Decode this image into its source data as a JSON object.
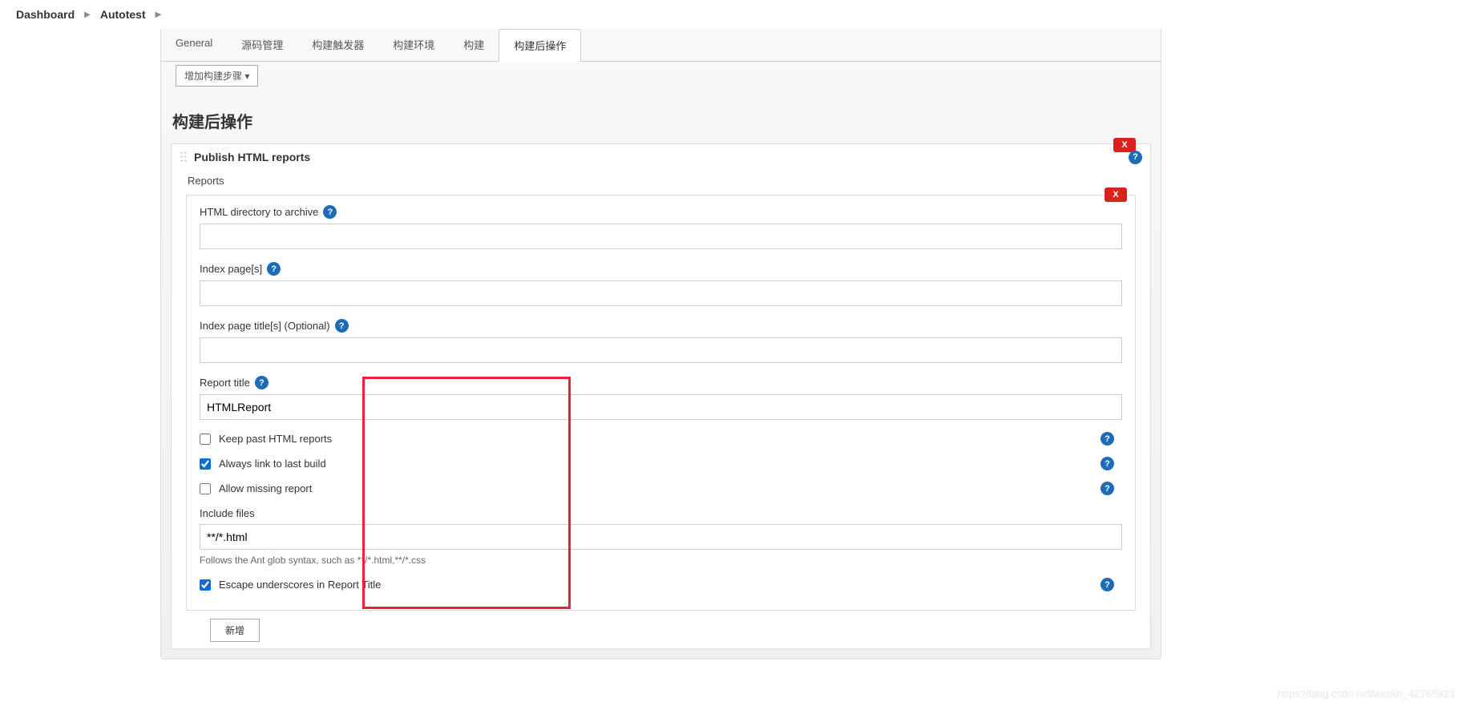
{
  "breadcrumb": {
    "items": [
      "Dashboard",
      "Autotest"
    ]
  },
  "tabs": {
    "items": [
      "General",
      "源码管理",
      "构建触发器",
      "构建环境",
      "构建",
      "构建后操作"
    ],
    "activeIndex": 5
  },
  "addStep": "增加构建步骤",
  "sectionTitle": "构建后操作",
  "panel": {
    "title": "Publish HTML reports",
    "reportsLabel": "Reports",
    "deleteLabel": "X",
    "fields": {
      "htmlDir": {
        "label": "HTML directory to archive",
        "value": ""
      },
      "indexPages": {
        "label": "Index page[s]",
        "value": ""
      },
      "indexTitles": {
        "label": "Index page title[s] (Optional)",
        "value": ""
      },
      "reportTitle": {
        "label": "Report title",
        "value": "HTMLReport"
      },
      "includeFiles": {
        "label": "Include files",
        "value": "**/*.html",
        "desc": "Follows the Ant glob syntax, such as **/*.html,**/*.css"
      }
    },
    "checks": {
      "keepPast": {
        "label": "Keep past HTML reports",
        "checked": false
      },
      "alwaysLink": {
        "label": "Always link to last build",
        "checked": true
      },
      "allowMissing": {
        "label": "Allow missing report",
        "checked": false
      },
      "escapeUnderscore": {
        "label": "Escape underscores in Report Title",
        "checked": true
      }
    }
  },
  "addNew": "新增",
  "watermark": "https://blog.csdn.net/weixin_42765923"
}
